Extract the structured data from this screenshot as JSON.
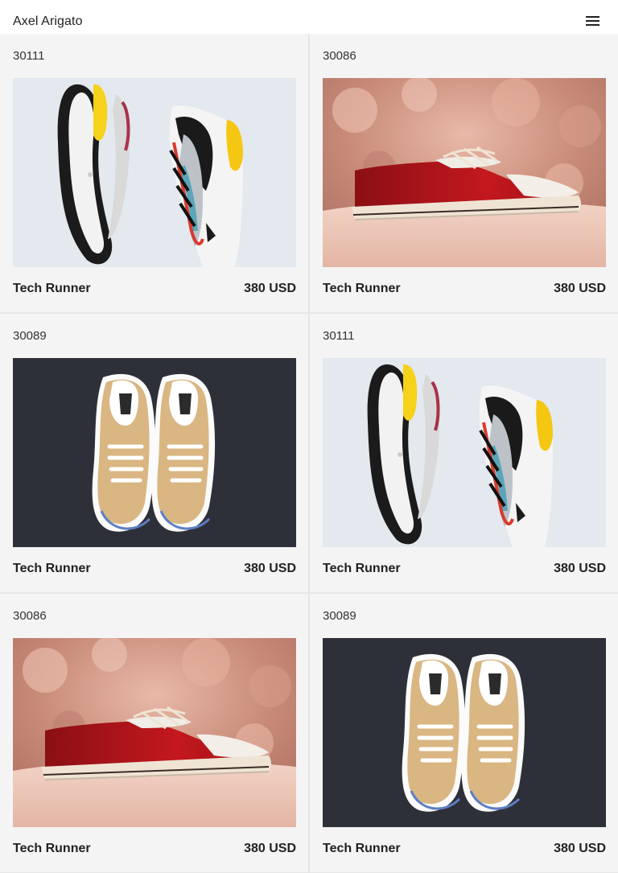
{
  "header": {
    "brand": "Axel Arigato",
    "menu_icon": "hamburger-menu-icon"
  },
  "products": [
    {
      "sku": "30111",
      "image": "white-yellow-runner-pair",
      "name": "Tech Runner",
      "price": "380 USD"
    },
    {
      "sku": "30086",
      "image": "red-canvas-sneaker",
      "name": "Tech Runner",
      "price": "380 USD"
    },
    {
      "sku": "30089",
      "image": "tan-canvas-sneaker-pair",
      "name": "Tech Runner",
      "price": "380 USD"
    },
    {
      "sku": "30111",
      "image": "white-yellow-runner-pair",
      "name": "Tech Runner",
      "price": "380 USD"
    },
    {
      "sku": "30086",
      "image": "red-canvas-sneaker",
      "name": "Tech Runner",
      "price": "380 USD"
    },
    {
      "sku": "30089",
      "image": "tan-canvas-sneaker-pair",
      "name": "Tech Runner",
      "price": "380 USD"
    }
  ]
}
